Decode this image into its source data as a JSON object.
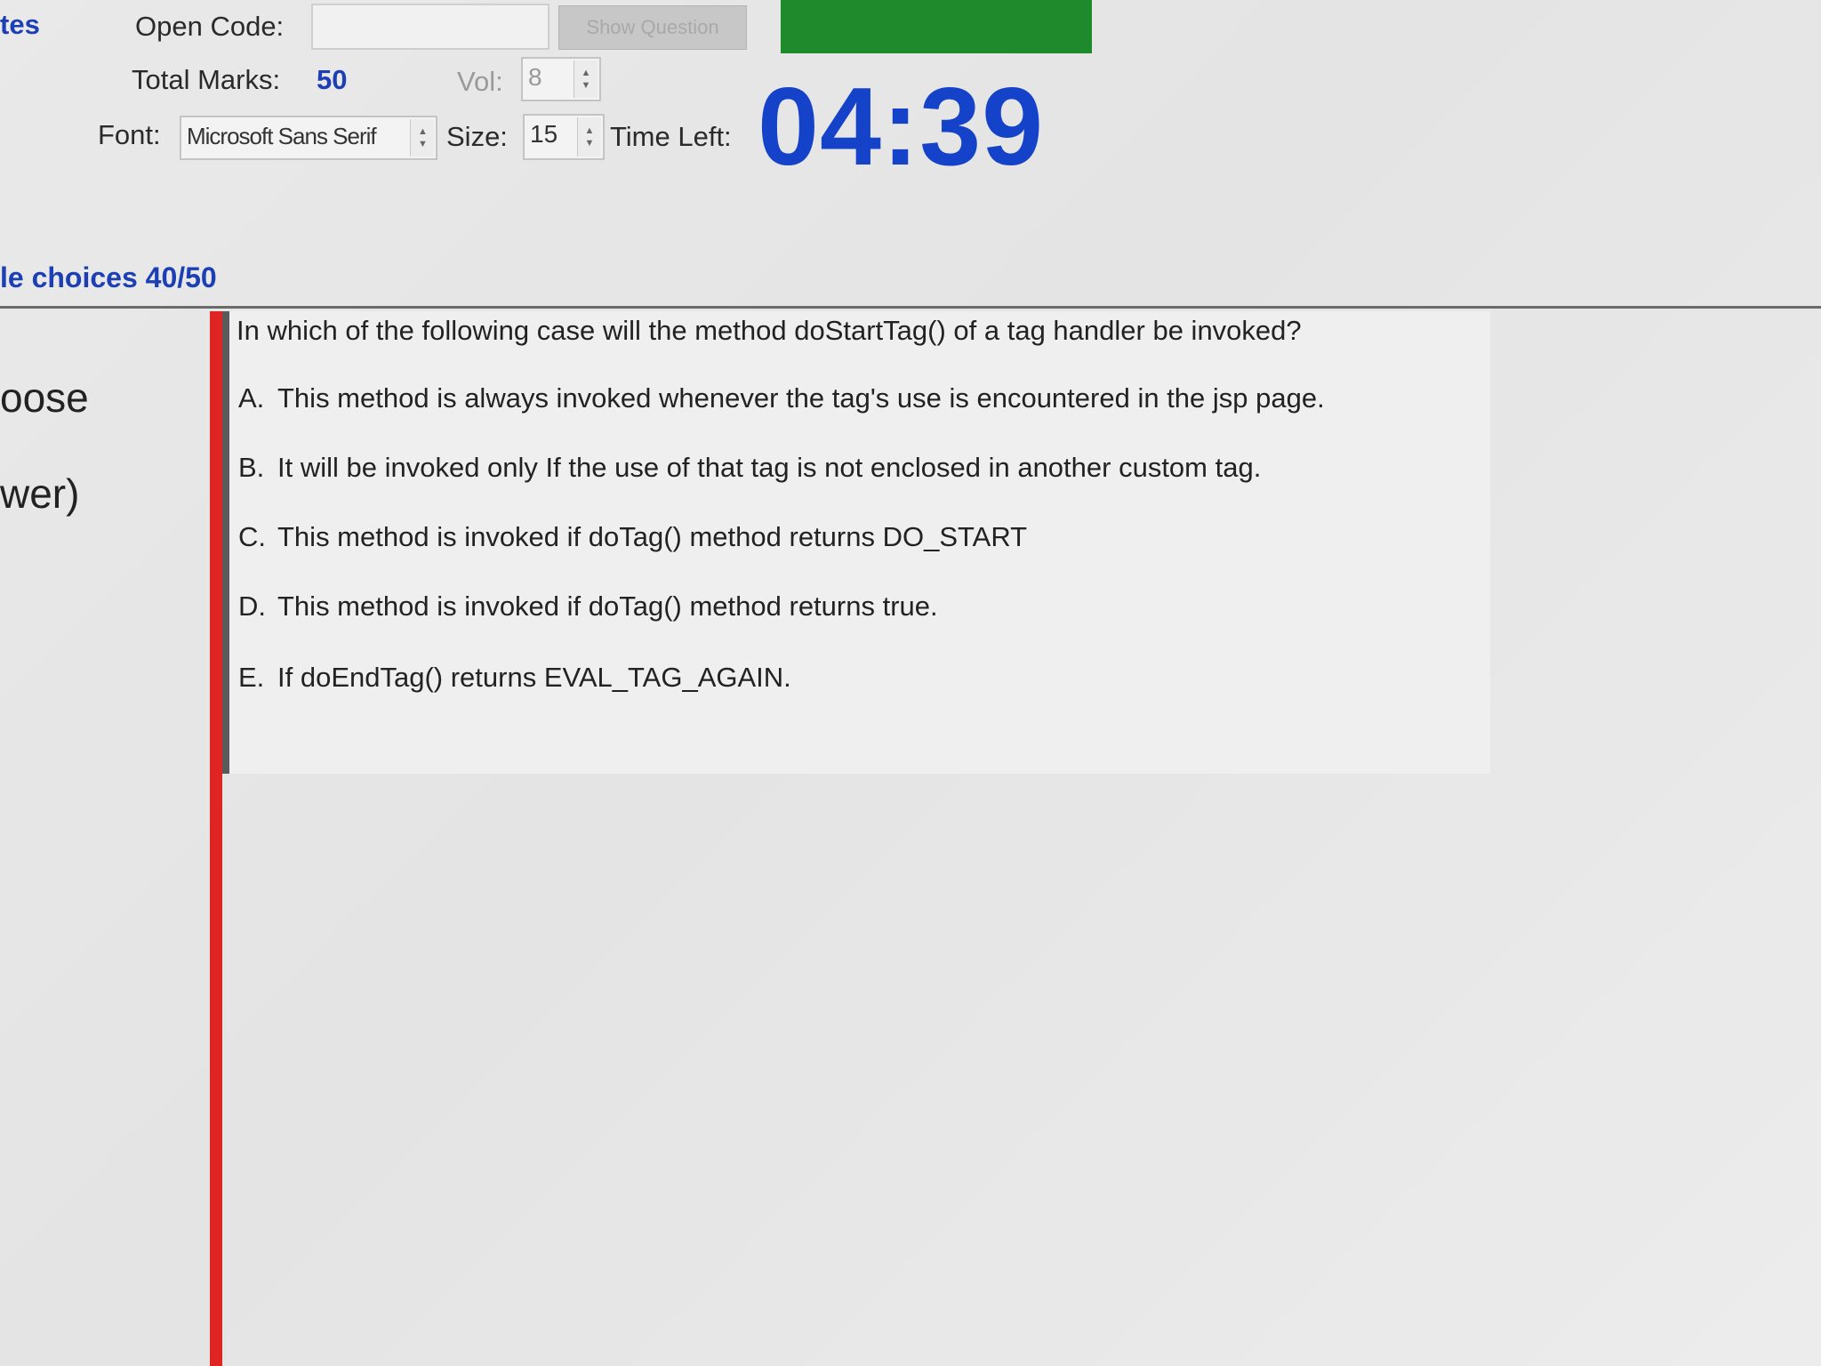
{
  "header": {
    "partial_left_label": "tes",
    "open_code_label": "Open Code:",
    "open_code_value": "",
    "show_question_label": "Show Question",
    "total_marks_label": "Total Marks:",
    "total_marks_value": "50",
    "vol_label": "Vol:",
    "vol_value": "8",
    "font_label": "Font:",
    "font_value": "Microsoft Sans Serif",
    "size_label": "Size:",
    "size_value": "15",
    "time_left_label": "Time Left:",
    "time_left_value": "04:39"
  },
  "section": {
    "progress_label": "le choices 40/50"
  },
  "left_panel": {
    "line1": "oose",
    "line2": "wer)"
  },
  "question": {
    "text": "In which of the following case will the method doStartTag() of a tag handler be invoked?",
    "options": [
      {
        "letter": "A.",
        "text": "This method is always invoked whenever the tag's use is encountered in the jsp page."
      },
      {
        "letter": "B.",
        "text": "It will be invoked only If the use of that tag is not enclosed in another custom tag."
      },
      {
        "letter": "C.",
        "text": "This method is invoked if doTag() method returns DO_START"
      },
      {
        "letter": "D.",
        "text": "This method is invoked if doTag() method returns true."
      },
      {
        "letter": "E.",
        "text": "If doEndTag() returns EVAL_TAG_AGAIN."
      }
    ]
  },
  "colors": {
    "accent_blue": "#1442c8",
    "status_green": "#1e8a2c",
    "marker_red": "#df2424"
  }
}
